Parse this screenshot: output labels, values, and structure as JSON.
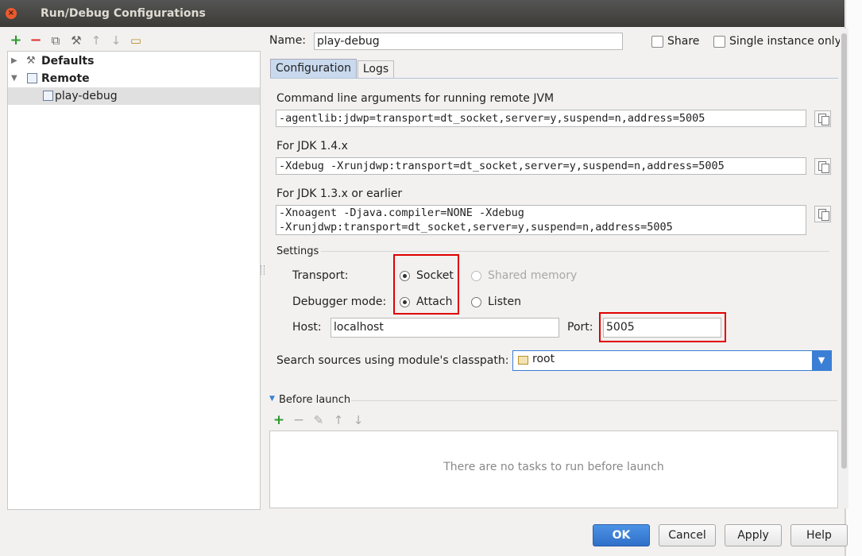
{
  "window": {
    "title": "Run/Debug Configurations",
    "close_glyph": "×"
  },
  "toolbar": {
    "add_glyph": "+",
    "remove_glyph": "−",
    "copy_glyph": "⧉",
    "wrench_glyph": "⚒",
    "up_glyph": "↑",
    "down_glyph": "↓",
    "folder_glyph": "▭",
    "icons": [
      "add-icon",
      "remove-icon",
      "copy-icon",
      "wrench-icon",
      "move-up-icon",
      "move-down-icon",
      "folder-icon"
    ]
  },
  "tree": {
    "items": [
      {
        "label": "Defaults",
        "arrow": "▶"
      },
      {
        "label": "Remote",
        "arrow": "▼"
      },
      {
        "label": "play-debug"
      }
    ]
  },
  "config": {
    "name_label": "Name:",
    "name_value": "play-debug",
    "share_label": "Share",
    "single_instance_label": "Single instance only"
  },
  "tabs": [
    {
      "label": "Configuration"
    },
    {
      "label": "Logs"
    }
  ],
  "cmd": {
    "label": "Command line arguments for running remote JVM",
    "value": "-agentlib:jdwp=transport=dt_socket,server=y,suspend=n,address=5005"
  },
  "jdk14": {
    "label": "For JDK 1.4.x",
    "value": "-Xdebug -Xrunjdwp:transport=dt_socket,server=y,suspend=n,address=5005"
  },
  "jdk13": {
    "label": "For JDK 1.3.x or earlier",
    "line1": "-Xnoagent -Djava.compiler=NONE -Xdebug",
    "line2": "-Xrunjdwp:transport=dt_socket,server=y,suspend=n,address=5005"
  },
  "settings": {
    "title": "Settings",
    "transport_label": "Transport:",
    "socket_label": "Socket",
    "shared_memory_label": "Shared memory",
    "mode_label": "Debugger mode:",
    "attach_label": "Attach",
    "listen_label": "Listen",
    "host_label": "Host:",
    "host_value": "localhost",
    "port_label": "Port:",
    "port_value": "5005"
  },
  "classpath": {
    "label": "Search sources using module's classpath:",
    "value": "root",
    "dropdown_glyph": "▼"
  },
  "before_launch": {
    "title": "Before launch",
    "collapse_glyph": "▼",
    "add_glyph": "+",
    "remove_glyph": "−",
    "edit_glyph": "✎",
    "up_glyph": "↑",
    "down_glyph": "↓",
    "empty_text": "There are no tasks to run before launch"
  },
  "buttons": {
    "ok": "OK",
    "cancel": "Cancel",
    "apply": "Apply",
    "help": "Help"
  },
  "colors": {
    "accent": "#3a7fd5",
    "highlight": "#e00000",
    "add_green": "#2e9a2e",
    "remove_red": "#d33"
  }
}
